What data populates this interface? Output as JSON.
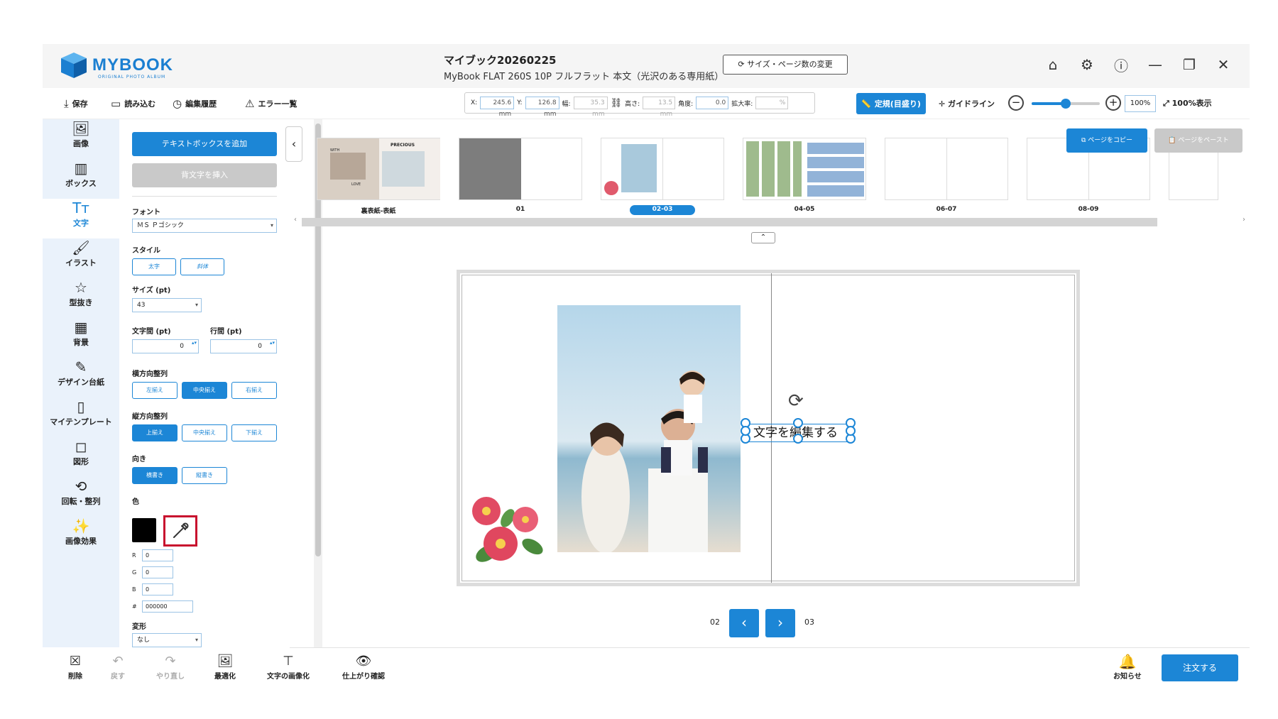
{
  "app": {
    "logo_name": "MYBOOK",
    "logo_tagline": "ORIGINAL PHOTO ALBUM",
    "doc_title": "マイブック20260225",
    "doc_subtitle": "MyBook FLAT 260S 10P フルフラット 本文（光沢のある専用紙）",
    "size_change_label": "サイズ・ページ数の変更"
  },
  "toolbar": {
    "save": "保存",
    "load": "読み込む",
    "history": "編集履歴",
    "errors": "エラー一覧",
    "x_label": "X:",
    "x_value": "245.6 mm",
    "y_label": "Y:",
    "y_value": "126.8 mm",
    "w_label": "幅:",
    "w_value": "35.3 mm",
    "h_label": "高さ:",
    "h_value": "13.5 mm",
    "angle_label": "角度:",
    "angle_value": "0.0",
    "scale_label": "拡大率:",
    "scale_value": "",
    "scale_unit": "%",
    "ruler_label": "定規(目盛り)",
    "guide_label": "ガイドライン",
    "zoom_value": "100%",
    "zoom_level": 0.5,
    "fit_label": "100%表示"
  },
  "rail": [
    {
      "label": "画像",
      "icon": "image-icon"
    },
    {
      "label": "ボックス",
      "icon": "box-icon"
    },
    {
      "label": "文字",
      "icon": "text-icon"
    },
    {
      "label": "イラスト",
      "icon": "brush-icon"
    },
    {
      "label": "型抜き",
      "icon": "star-icon"
    },
    {
      "label": "背景",
      "icon": "checker-icon"
    },
    {
      "label": "デザイン台紙",
      "icon": "pen-icon"
    },
    {
      "label": "マイテンプレート",
      "icon": "template-icon"
    },
    {
      "label": "図形",
      "icon": "shape-icon"
    },
    {
      "label": "回転・整列",
      "icon": "rotate-icon"
    },
    {
      "label": "画像効果",
      "icon": "wand-icon"
    }
  ],
  "panel": {
    "add_textbox": "テキストボックスを追加",
    "insert_spine": "背文字を挿入",
    "font_label": "フォント",
    "font_value": "ＭＳ Ｐゴシック",
    "style_label": "スタイル",
    "bold": "太字",
    "italic": "斜体",
    "size_label": "サイズ (pt)",
    "size_value": "43",
    "char_spacing_label": "文字間 (pt)",
    "char_spacing_value": "0",
    "line_spacing_label": "行間 (pt)",
    "line_spacing_value": "0",
    "h_align_label": "横方向整列",
    "h_left": "左揃え",
    "h_center": "中央揃え",
    "h_right": "右揃え",
    "v_align_label": "縦方向整列",
    "v_top": "上揃え",
    "v_middle": "中央揃え",
    "v_bottom": "下揃え",
    "direction_label": "向き",
    "horizontal": "横書き",
    "vertical": "縦書き",
    "color_label": "色",
    "color_value": "#000000",
    "r_label": "R",
    "r_value": "0",
    "g_label": "G",
    "g_value": "0",
    "b_label": "B",
    "b_value": "0",
    "hex_label": "#",
    "hex_value": "000000",
    "transform_label": "変形",
    "transform_value": "なし"
  },
  "thumbnails": [
    {
      "label": "裏表紙-表紙",
      "selected": false
    },
    {
      "label": "01",
      "selected": false
    },
    {
      "label": "02-03",
      "selected": true
    },
    {
      "label": "04-05",
      "selected": false
    },
    {
      "label": "06-07",
      "selected": false
    },
    {
      "label": "08-09",
      "selected": false
    }
  ],
  "thumb_text": {
    "precious": "PRECIOUS",
    "with": "WITH",
    "love": "LOVE"
  },
  "page_copy": "ページをコピー",
  "page_paste": "ページをペースト",
  "editor": {
    "textbox_text": "文字を編集する",
    "left_page": "02",
    "right_page": "03"
  },
  "bottom": {
    "delete": "削除",
    "undo": "戻す",
    "redo": "やり直し",
    "optimize": "最適化",
    "text_to_image": "文字の画像化",
    "preview": "仕上がり確認",
    "notify": "お知らせ",
    "order": "注文する"
  },
  "colors": {
    "accent": "#1c86d6",
    "highlight": "#c8102e"
  }
}
